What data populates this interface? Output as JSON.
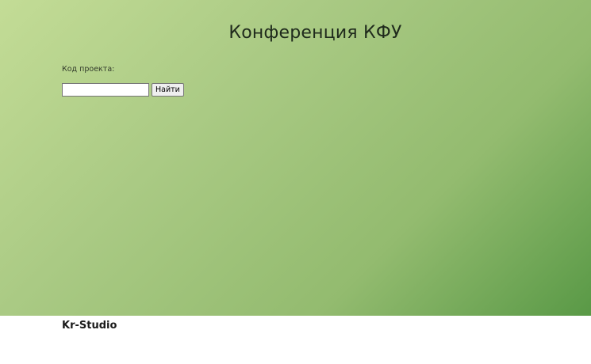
{
  "hero": {
    "title": "Конференция КФУ",
    "colors": {
      "gradient_start": "#c3dc96",
      "gradient_end": "#599946"
    }
  },
  "search_form": {
    "label": "Код проекта:",
    "input_value": "",
    "button_label": "Найти"
  },
  "footer": {
    "brand": "Kr-Studio"
  }
}
